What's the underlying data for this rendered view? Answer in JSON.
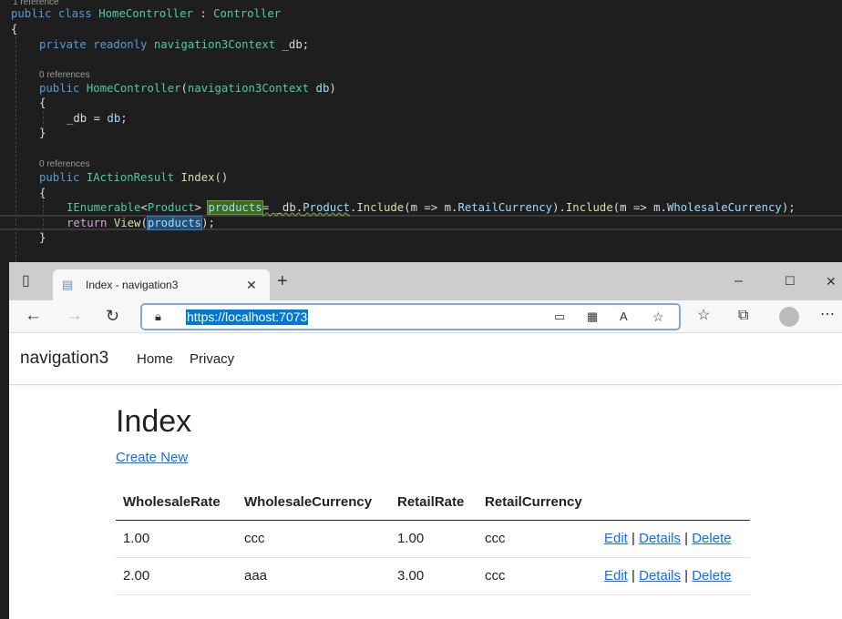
{
  "ide": {
    "class_refs": "1 reference",
    "ctor_refs": "0 references",
    "index_refs": "0 references",
    "code": {
      "l1a": "public class ",
      "l1b": "HomeController",
      "l1c": " : ",
      "l1d": "Controller",
      "brace": "{",
      "close": "}",
      "l2a": "private readonly ",
      "l2b": "navigation3Context",
      "l2c": " _db;",
      "l3a": "public ",
      "l3b": "HomeController",
      "l3c": "(",
      "l3d": "navigation3Context",
      "l3e": " db",
      ")": ")",
      "l4a": "_db = ",
      "l4b": "db",
      "l4c": ";",
      "l5a": "public ",
      "l5b": "IActionResult",
      "l5c": " Index()",
      "l6a": "IEnumerable",
      "l6b": "<",
      "l6c": "Product",
      "l6d": "> ",
      "l6e": "products",
      "l6f": "= _db.",
      "l6g": "Product",
      "l6h": ".",
      "l6i": "Include",
      "l6j": "(m => m.",
      "l6k": "RetailCurrency",
      "l6l": ").",
      "l6m": "Include",
      "l6n": "(m => m.",
      "l6o": "WholesaleCurrency",
      "l6p": ");",
      "l7a": "return ",
      "l7b": "View",
      "l7c": "(",
      "l7d": "products",
      "l7e": ");"
    }
  },
  "browser": {
    "tab_title": "Index - navigation3",
    "url": "https://localhost:7073",
    "icons": [
      "tab-actions-icon",
      "page-icon",
      "close-tab-icon",
      "new-tab-icon",
      "minimize-icon",
      "maximize-icon",
      "close-window-icon",
      "back-icon",
      "forward-icon",
      "refresh-icon",
      "lock-icon",
      "app-available-icon",
      "qr-code-icon",
      "read-aloud-icon",
      "add-favorite-icon",
      "favorites-icon",
      "collections-icon",
      "profile-icon",
      "more-icon"
    ]
  },
  "site": {
    "brand": "navigation3",
    "nav": [
      "Home",
      "Privacy"
    ],
    "title": "Index",
    "create_new": "Create New",
    "table": {
      "headers": [
        "WholesaleRate",
        "WholesaleCurrency",
        "RetailRate",
        "RetailCurrency"
      ],
      "rows": [
        [
          "1.00",
          "ccc",
          "1.00",
          "ccc"
        ],
        [
          "2.00",
          "aaa",
          "3.00",
          "ccc"
        ]
      ],
      "actions": [
        "Edit",
        "Details",
        "Delete"
      ],
      "sep": "|"
    }
  }
}
